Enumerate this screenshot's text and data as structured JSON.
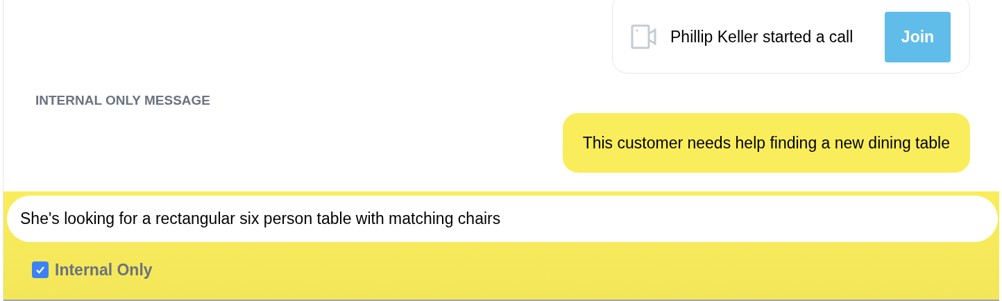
{
  "call_notice": {
    "text": "Phillip Keller started a call",
    "button": "Join"
  },
  "messages": [
    {
      "kind": "label",
      "text": "INTERNAL ONLY MESSAGE"
    },
    {
      "kind": "internal",
      "text": "This customer needs help finding a new dining table"
    }
  ],
  "composer": {
    "value": "She's looking for a rectangular six person table with matching chairs",
    "internal_only": {
      "label": "Internal Only",
      "checked": true
    }
  }
}
